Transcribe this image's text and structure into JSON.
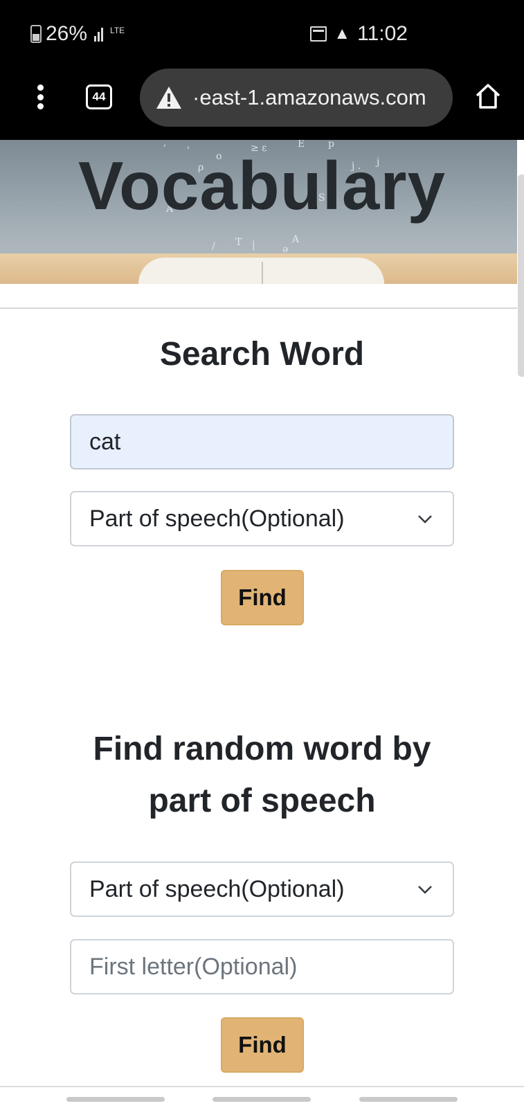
{
  "status_bar": {
    "battery": "26%",
    "network": "LTE",
    "time": "11:02"
  },
  "browser": {
    "tab_count": "44",
    "url": "·east-1.amazonaws.com"
  },
  "hero": {
    "title": "Vocabulary"
  },
  "search_section": {
    "title": "Search Word",
    "word_value": "cat",
    "pos_select": "Part of speech(Optional)",
    "find_label": "Find"
  },
  "random_section": {
    "title_line1": "Find random word by",
    "title_line2": "part of speech",
    "pos_select": "Part of speech(Optional)",
    "first_letter_placeholder": "First letter(Optional)",
    "find_label": "Find"
  },
  "colors": {
    "accent_button": "#e1b475",
    "filled_input": "#e8f0fe"
  }
}
